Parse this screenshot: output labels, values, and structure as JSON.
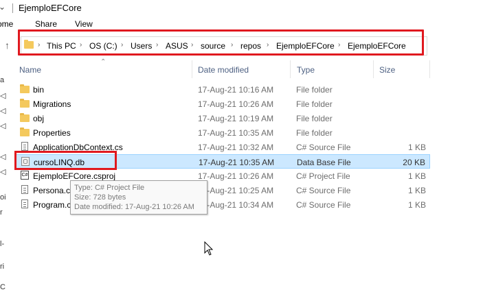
{
  "window": {
    "title": "EjemploEFCore",
    "title_chevron": "⌄"
  },
  "ribbon": {
    "tabs": [
      {
        "label": "ome"
      },
      {
        "label": "Share"
      },
      {
        "label": "View"
      }
    ]
  },
  "address_bar": {
    "up_icon": "↑",
    "separator": "›",
    "crumbs": [
      "This PC",
      "OS (C:)",
      "Users",
      "ASUS",
      "source",
      "repos",
      "EjemploEFCore",
      "EjemploEFCore"
    ]
  },
  "left_pane": {
    "chars": [
      "a",
      "◁",
      "◁",
      "◁",
      "◁",
      "◁",
      "oi",
      "r",
      "l-",
      "ri",
      "C"
    ]
  },
  "columns": {
    "name": "Name",
    "date": "Date modified",
    "type": "Type",
    "size": "Size",
    "sort_indicator": "⌃"
  },
  "files": [
    {
      "name": "bin",
      "date": "17-Aug-21 10:16 AM",
      "type": "File folder",
      "size": "",
      "icon": "folder-icon"
    },
    {
      "name": "Migrations",
      "date": "17-Aug-21 10:26 AM",
      "type": "File folder",
      "size": "",
      "icon": "folder-icon"
    },
    {
      "name": "obj",
      "date": "17-Aug-21 10:19 AM",
      "type": "File folder",
      "size": "",
      "icon": "folder-icon"
    },
    {
      "name": "Properties",
      "date": "17-Aug-21 10:35 AM",
      "type": "File folder",
      "size": "",
      "icon": "folder-icon"
    },
    {
      "name": "ApplicationDbContext.cs",
      "date": "17-Aug-21 10:32 AM",
      "type": "C# Source File",
      "size": "1 KB",
      "icon": "cs-file-icon"
    },
    {
      "name": "cursoLINQ.db",
      "date": "17-Aug-21 10:35 AM",
      "type": "Data Base File",
      "size": "20 KB",
      "icon": "database-file-icon",
      "selected": true
    },
    {
      "name": "EjemploEFCore.csproj",
      "date": "17-Aug-21 10:26 AM",
      "type": "C# Project File",
      "size": "1 KB",
      "icon": "csproj-file-icon",
      "badge": "C#"
    },
    {
      "name": "Persona.cs",
      "date": "17-Aug-21 10:25 AM",
      "type": "C# Source File",
      "size": "1 KB",
      "icon": "cs-file-icon"
    },
    {
      "name": "Program.cs",
      "date": "17-Aug-21 10:34 AM",
      "type": "C# Source File",
      "size": "1 KB",
      "icon": "cs-file-icon"
    }
  ],
  "tooltip": {
    "type_line": "Type: C# Project File",
    "size_line": "Size: 728 bytes",
    "date_line": "Date modified: 17-Aug-21 10:26 AM"
  },
  "colors": {
    "highlight_red": "#e0181e",
    "selection_bg": "#cce8ff",
    "folder_yellow": "#f4c95d",
    "header_text": "#4d6082"
  }
}
